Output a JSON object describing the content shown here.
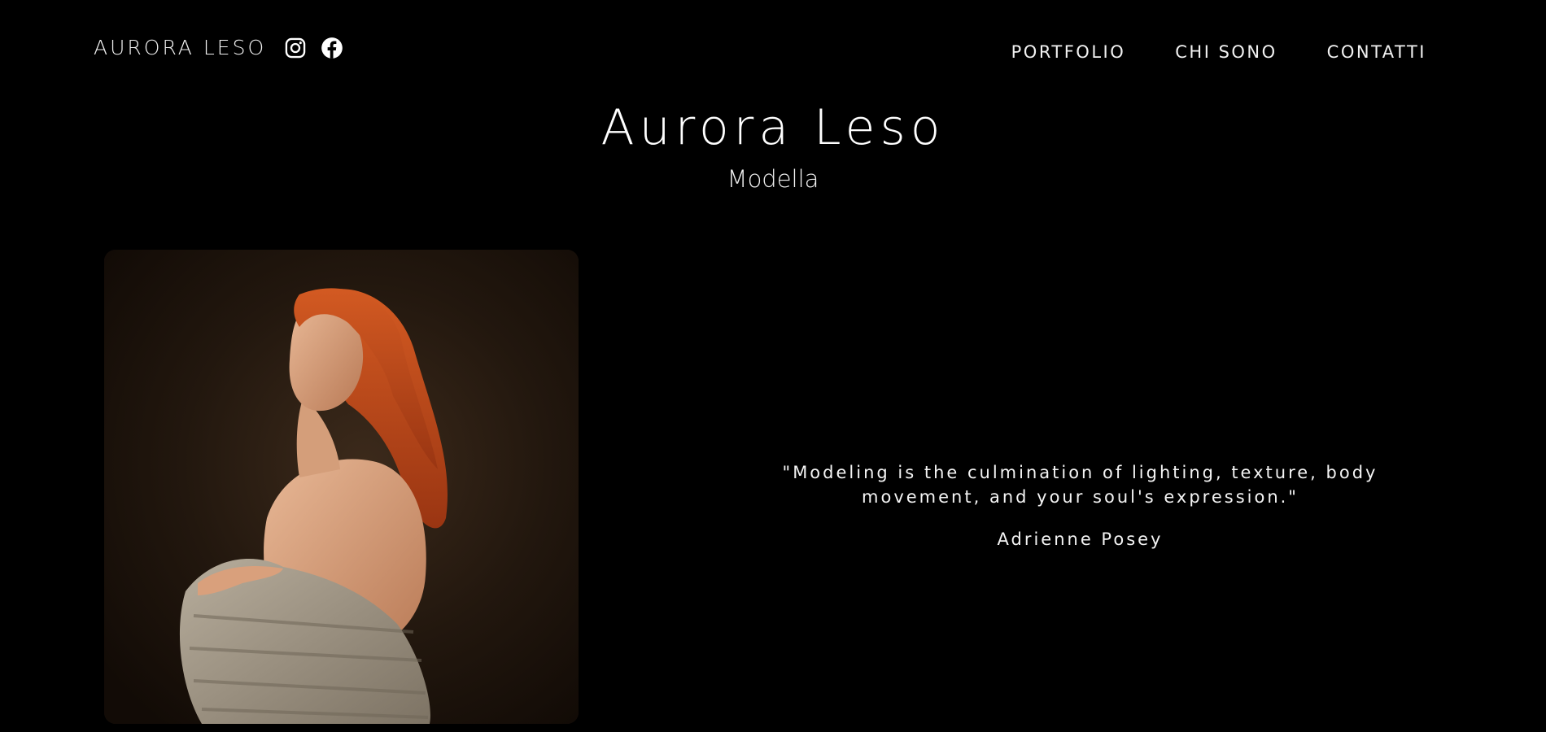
{
  "header": {
    "brand": "AURORA LESO",
    "social": [
      {
        "icon": "instagram-icon"
      },
      {
        "icon": "facebook-icon"
      }
    ],
    "nav": [
      {
        "label": "PORTFOLIO"
      },
      {
        "label": "CHI SONO"
      },
      {
        "label": "CONTATTI"
      }
    ]
  },
  "hero": {
    "title": "Aurora Leso",
    "subtitle": "Modella"
  },
  "quote": {
    "text": "\"Modeling is the culmination of lighting, texture, body movement, and your soul's expression.\"",
    "author": "Adrienne Posey"
  },
  "colors": {
    "background": "#000000",
    "text": "#ffffff",
    "hair": "#c2461a",
    "sweater": "#a59a88"
  }
}
